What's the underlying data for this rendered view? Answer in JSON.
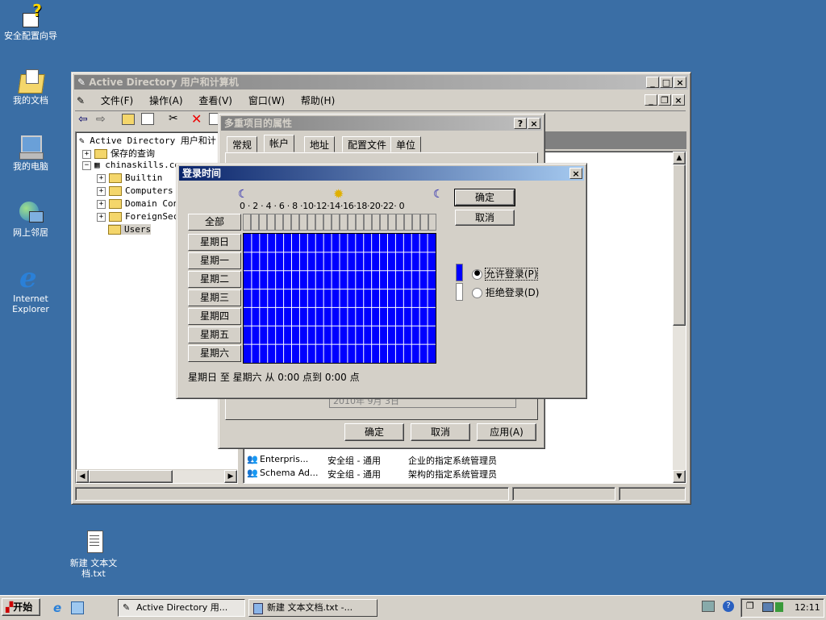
{
  "desktop": {
    "icons": [
      {
        "label": "安全配置向导",
        "icon": "wizard-icon"
      },
      {
        "label": "我的文档",
        "icon": "documents-folder-icon"
      },
      {
        "label": "我的电脑",
        "icon": "computer-icon"
      },
      {
        "label": "网上邻居",
        "icon": "network-icon"
      },
      {
        "label": "Internet Explorer",
        "icon": "ie-icon"
      },
      {
        "label": "新建 文本文档.txt",
        "icon": "text-file-icon"
      }
    ]
  },
  "ad_window": {
    "title": "Active Directory 用户和计算机",
    "menu": [
      "文件(F)",
      "操作(A)",
      "查看(V)",
      "窗口(W)",
      "帮助(H)"
    ],
    "tree": {
      "root": "Active Directory 用户和计",
      "items": [
        "保存的查询",
        "chinaskills.co",
        "Builtin",
        "Computers",
        "Domain Cont",
        "ForeignSecu",
        "Users"
      ]
    },
    "rows": [
      {
        "name": "Enterpris...",
        "type": "安全组 - 通用",
        "desc": "企业的指定系统管理员"
      },
      {
        "name": "Schema Ad...",
        "type": "安全组 - 通用",
        "desc": "架构的指定系统管理员"
      }
    ]
  },
  "props_dialog": {
    "title": "多重项目的属性",
    "tabs": [
      "常规",
      "帐户",
      "地址",
      "配置文件",
      "单位"
    ],
    "active_tab": "帐户",
    "hidden_text": "2010年 9月 3日",
    "buttons": {
      "ok": "确定",
      "cancel": "取消",
      "apply": "应用(A)"
    }
  },
  "logon_dialog": {
    "title": "登录时间",
    "all_label": "全部",
    "hour_labels": "0 · 2 · 4 · 6 · 8 ·10·12·14·16·18·20·22· 0",
    "days": [
      "星期日",
      "星期一",
      "星期二",
      "星期三",
      "星期四",
      "星期五",
      "星期六"
    ],
    "buttons": {
      "ok": "确定",
      "cancel": "取消"
    },
    "legend": {
      "permit": "允许登录(P)",
      "deny": "拒绝登录(D)",
      "permit_color": "#0000ff",
      "deny_color": "#ffffff"
    },
    "selected_option": "permit",
    "status": "星期日 至 星期六 从 0:00 点到 0:00 点",
    "grid_color": "#0000ff"
  },
  "taskbar": {
    "start": "开始",
    "tasks": [
      "Active Directory 用...",
      "新建 文本文档.txt -..."
    ],
    "clock": "12:11"
  }
}
